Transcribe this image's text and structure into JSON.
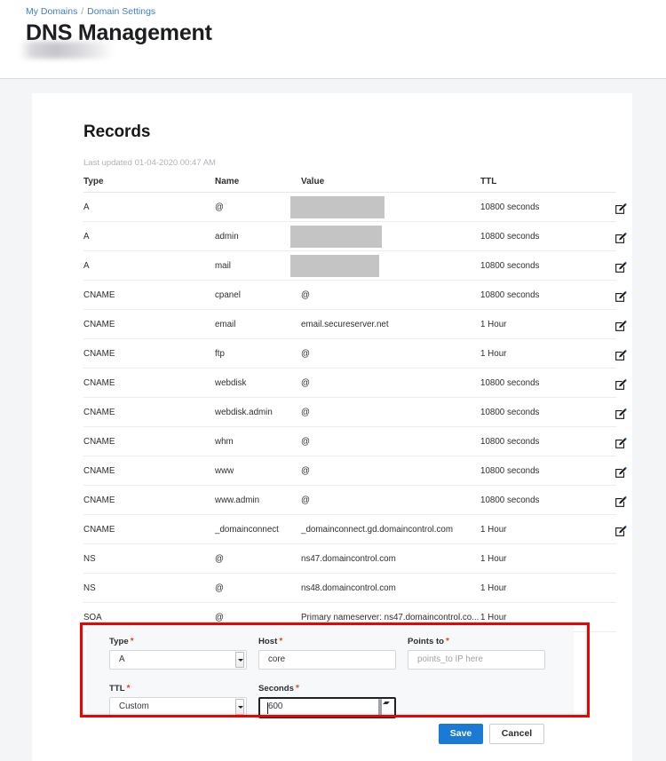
{
  "header": {
    "breadcrumb": {
      "items": [
        "My Domains",
        "Domain Settings"
      ],
      "separator": "/"
    },
    "title": "DNS Management",
    "domain_name_redacted": ""
  },
  "records": {
    "title": "Records",
    "last_updated": "Last updated 01-04-2020 00:47 AM",
    "columns": [
      "Type",
      "Name",
      "Value",
      "TTL"
    ],
    "edit_icon": "edit-pencil-icon",
    "rows": [
      {
        "type": "A",
        "name": "@",
        "value": "",
        "redacted": true,
        "redaction_width": 106,
        "ttl": "10800 seconds",
        "editable": true
      },
      {
        "type": "A",
        "name": "admin",
        "value": "",
        "redacted": true,
        "redaction_width": 103,
        "ttl": "10800 seconds",
        "editable": true
      },
      {
        "type": "A",
        "name": "mail",
        "value": "",
        "redacted": true,
        "redaction_width": 100,
        "ttl": "10800 seconds",
        "editable": true
      },
      {
        "type": "CNAME",
        "name": "cpanel",
        "value": "@",
        "redacted": false,
        "ttl": "10800 seconds",
        "editable": true
      },
      {
        "type": "CNAME",
        "name": "email",
        "value": "email.secureserver.net",
        "redacted": false,
        "ttl": "1 Hour",
        "editable": true
      },
      {
        "type": "CNAME",
        "name": "ftp",
        "value": "@",
        "redacted": false,
        "ttl": "1 Hour",
        "editable": true
      },
      {
        "type": "CNAME",
        "name": "webdisk",
        "value": "@",
        "redacted": false,
        "ttl": "10800 seconds",
        "editable": true
      },
      {
        "type": "CNAME",
        "name": "webdisk.admin",
        "value": "@",
        "redacted": false,
        "ttl": "10800 seconds",
        "editable": true
      },
      {
        "type": "CNAME",
        "name": "whm",
        "value": "@",
        "redacted": false,
        "ttl": "10800 seconds",
        "editable": true
      },
      {
        "type": "CNAME",
        "name": "www",
        "value": "@",
        "redacted": false,
        "ttl": "10800 seconds",
        "editable": true
      },
      {
        "type": "CNAME",
        "name": "www.admin",
        "value": "@",
        "redacted": false,
        "ttl": "10800 seconds",
        "editable": true
      },
      {
        "type": "CNAME",
        "name": "_domainconnect",
        "value": "_domainconnect.gd.domaincontrol.com",
        "redacted": false,
        "ttl": "1 Hour",
        "editable": true
      },
      {
        "type": "NS",
        "name": "@",
        "value": "ns47.domaincontrol.com",
        "redacted": false,
        "ttl": "1 Hour",
        "editable": false
      },
      {
        "type": "NS",
        "name": "@",
        "value": "ns48.domaincontrol.com",
        "redacted": false,
        "ttl": "1 Hour",
        "editable": false
      },
      {
        "type": "SOA",
        "name": "@",
        "value": "Primary nameserver: ns47.domaincontrol.co...",
        "redacted": false,
        "ttl": "1 Hour",
        "editable": false
      }
    ]
  },
  "add_record_form": {
    "highlight_color": "#f20000",
    "fields": {
      "type": {
        "label": "Type",
        "required": "*",
        "value": "A",
        "control": "select"
      },
      "host": {
        "label": "Host",
        "required": "*",
        "value": "core",
        "control": "text"
      },
      "points_to": {
        "label": "Points to",
        "required": "*",
        "value": "points_to IP here",
        "control": "text",
        "is_placeholder": true
      },
      "ttl": {
        "label": "TTL",
        "required": "*",
        "value": "Custom",
        "control": "select"
      },
      "seconds": {
        "label": "Seconds",
        "required": "*",
        "value": "600",
        "control": "number",
        "focused": true
      }
    }
  },
  "actions": {
    "save_label": "Save",
    "cancel_label": "Cancel",
    "save_color": "#1a7ad4"
  }
}
